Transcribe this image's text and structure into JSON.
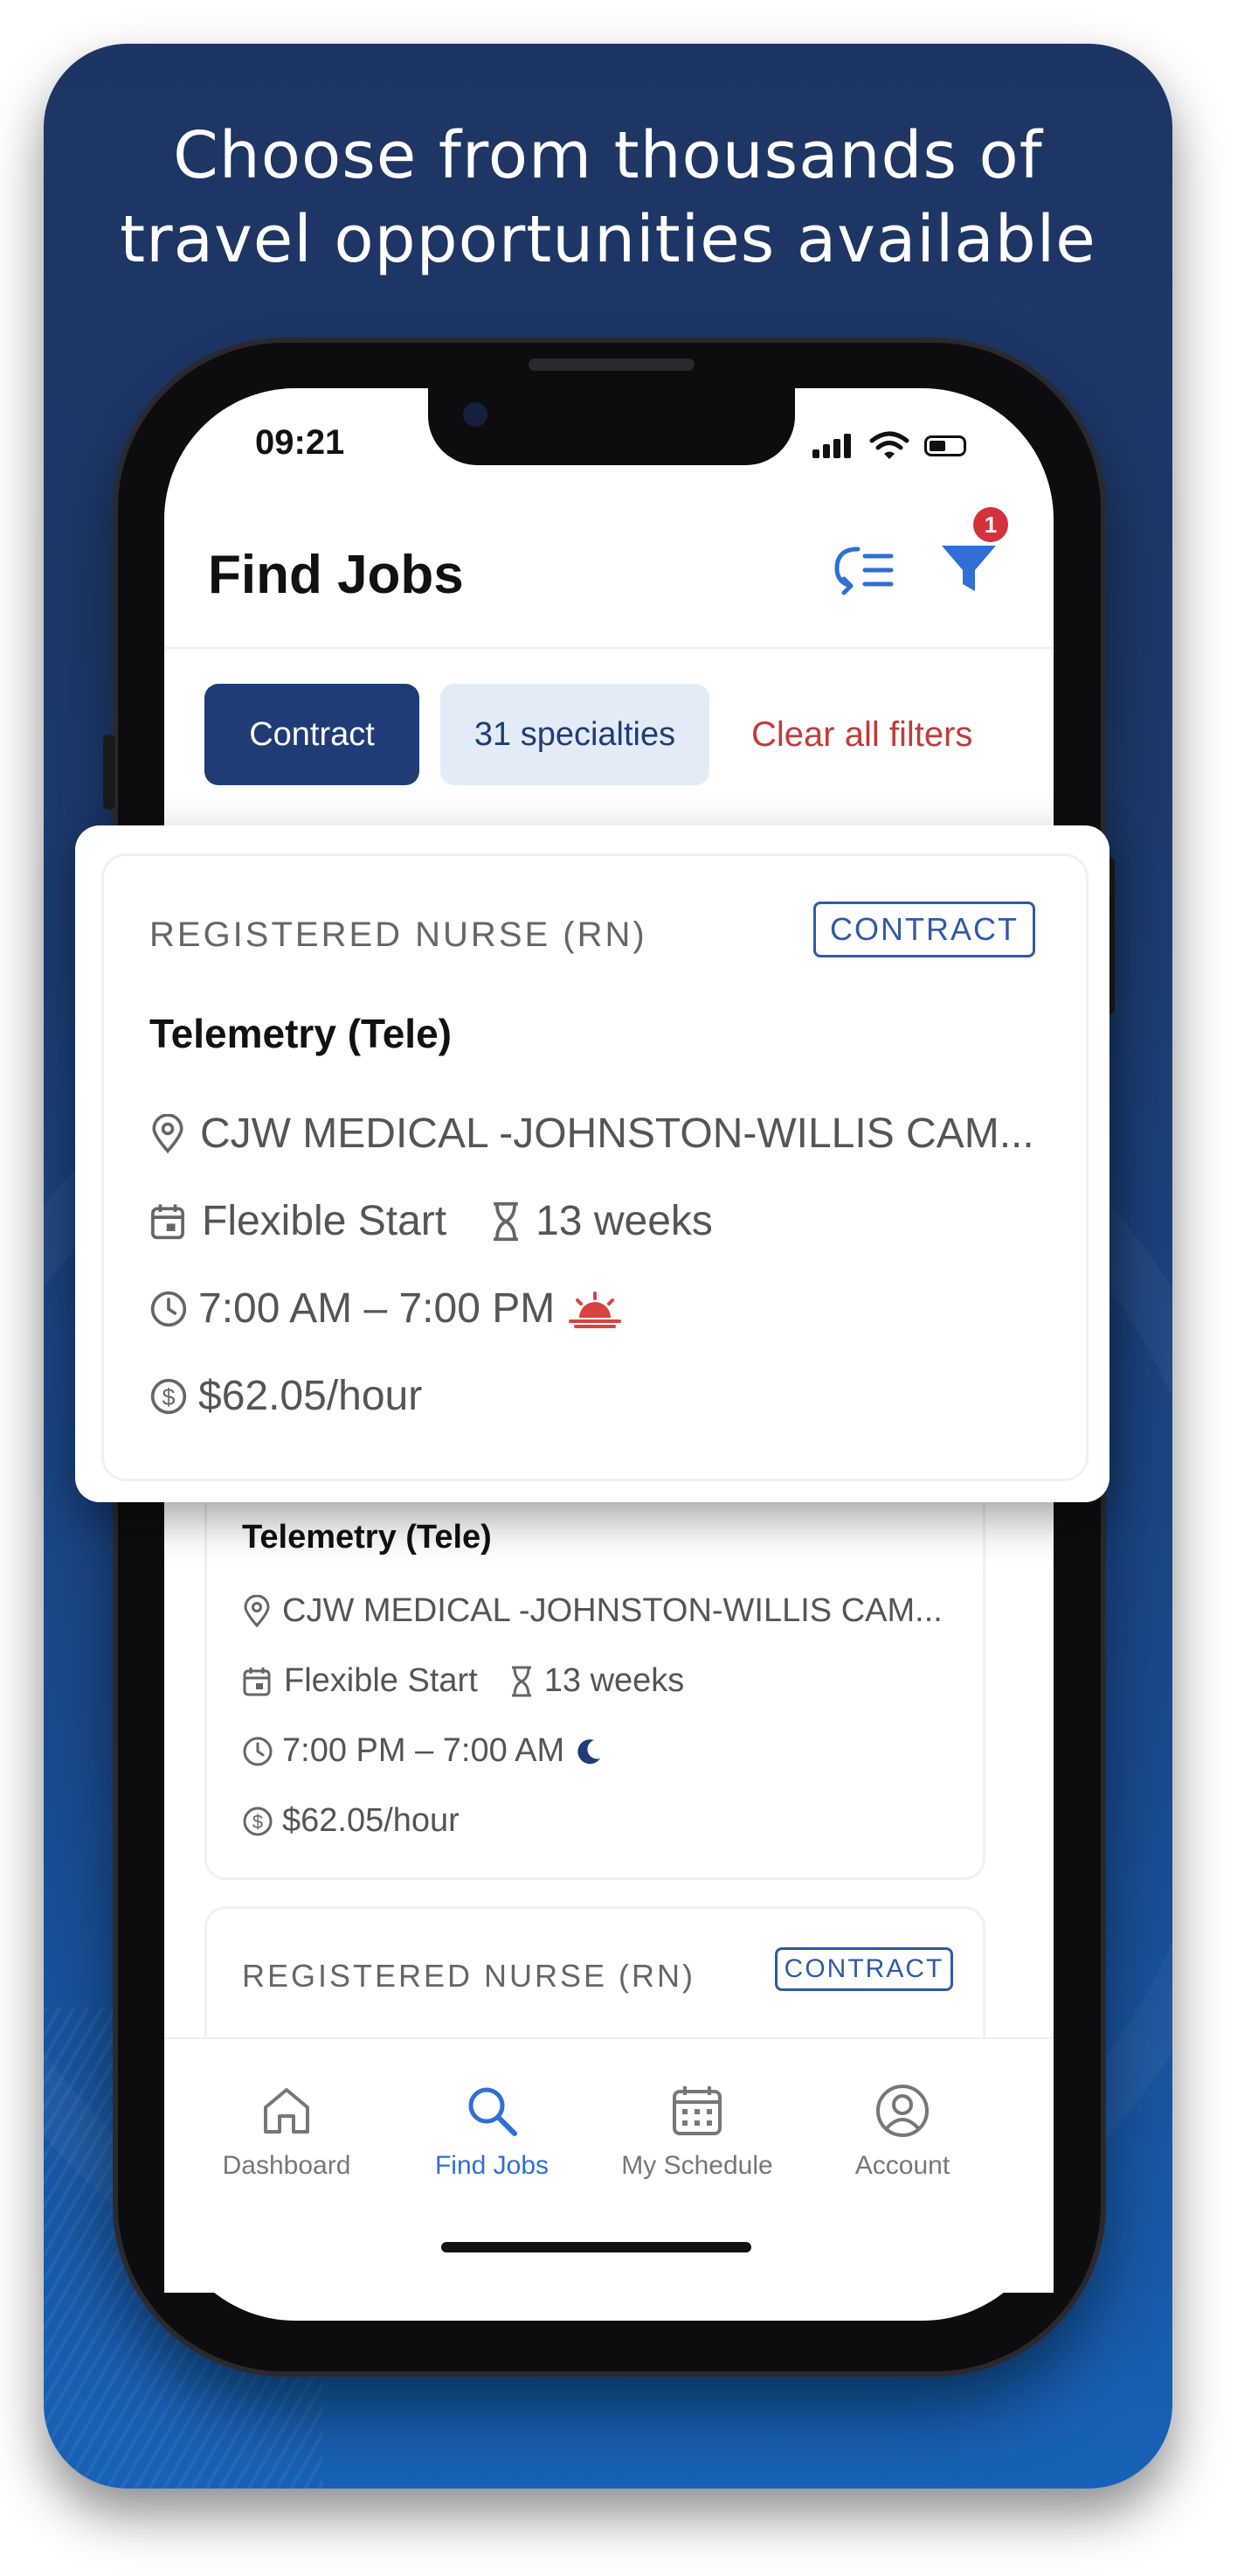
{
  "promo": {
    "headline_line1": "Choose from thousands of",
    "headline_line2": "travel opportunities available"
  },
  "status_bar": {
    "time": "09:21"
  },
  "header": {
    "title": "Find Jobs",
    "filter_badge": "1"
  },
  "filters": {
    "contract_chip": "Contract",
    "specialties_chip": "31 specialties",
    "clear_all": "Clear all filters"
  },
  "jobs": [
    {
      "role": "REGISTERED NURSE (RN)",
      "type_tag": "CONTRACT",
      "specialty": "Telemetry (Tele)",
      "facility": "CJW MEDICAL -JOHNSTON-WILLIS CAM...",
      "start": "Flexible Start",
      "duration": "13 weeks",
      "shift": "7:00 AM – 7:00 PM",
      "shift_icon": "sunrise-icon",
      "pay": "$62.05/hour"
    },
    {
      "specialty": "Telemetry (Tele)",
      "facility": "CJW MEDICAL -JOHNSTON-WILLIS CAM...",
      "start": "Flexible Start",
      "duration": "13 weeks",
      "shift": "7:00 PM – 7:00 AM",
      "shift_icon": "moon-icon",
      "pay": "$62.05/hour"
    },
    {
      "role": "REGISTERED NURSE (RN)",
      "type_tag": "CONTRACT"
    }
  ],
  "tabbar": {
    "items": [
      {
        "label": "Dashboard",
        "icon": "home-icon"
      },
      {
        "label": "Find Jobs",
        "icon": "search-icon",
        "active": true
      },
      {
        "label": "My Schedule",
        "icon": "calendar-icon"
      },
      {
        "label": "Account",
        "icon": "user-icon"
      }
    ]
  },
  "colors": {
    "brand_navy": "#1f3c76",
    "accent_blue": "#2f6fd6",
    "danger_red": "#c23b3b",
    "badge_red": "#d3313b",
    "sunrise_red": "#d9433f"
  }
}
